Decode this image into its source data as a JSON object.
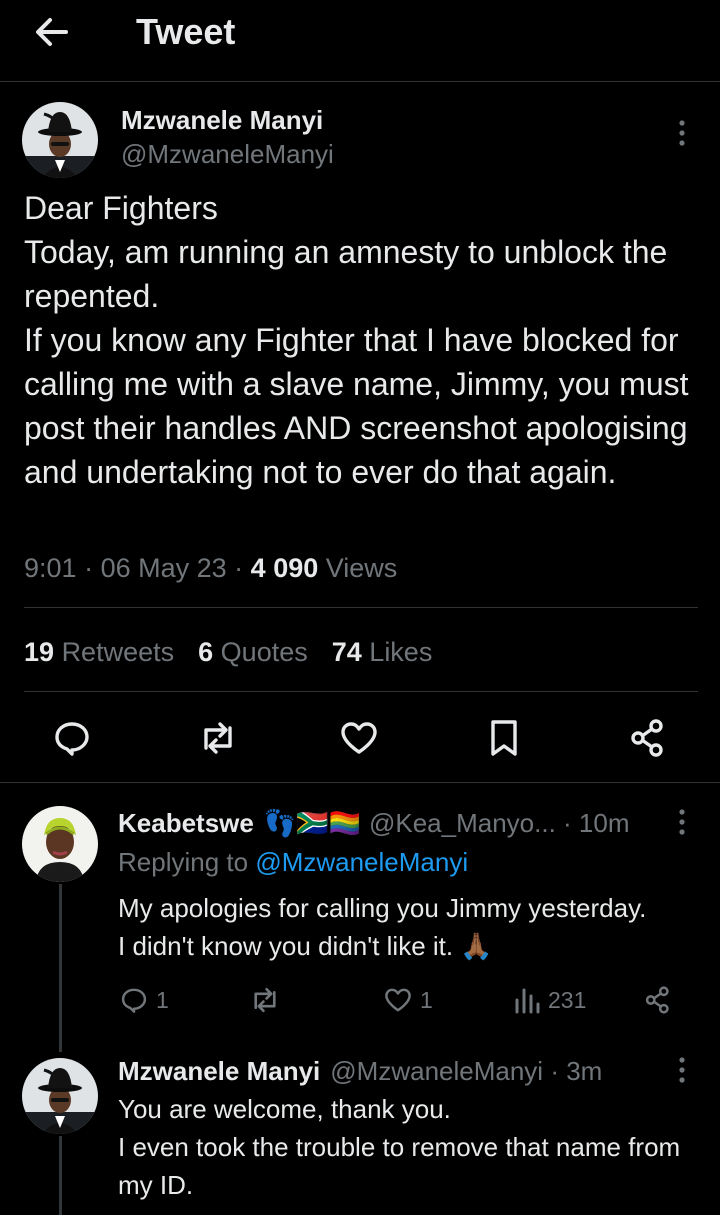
{
  "header": {
    "title": "Tweet",
    "back_icon": "arrow-left-icon"
  },
  "tweet": {
    "author_name": "Mzwanele Manyi",
    "author_handle": "@MzwaneleManyi",
    "text": "Dear Fighters\nToday, am running an amnesty to unblock the repented.\nIf you know any Fighter that I have blocked for calling me with a slave name, Jimmy,  you must post their handles AND screenshot apologising and undertaking not to ever do that again.",
    "time": "9:01",
    "date": "06 May 23",
    "views_count": "4 090",
    "views_label": "Views",
    "retweets_count": "19",
    "retweets_label": "Retweets",
    "quotes_count": "6",
    "quotes_label": "Quotes",
    "likes_count": "74",
    "likes_label": "Likes"
  },
  "replies": [
    {
      "author_name": "Keabetswe",
      "author_emoji": "👣🇿🇦🏳️‍🌈",
      "author_handle": "@Kea_Manyo...",
      "time": "10m",
      "replying_prefix": "Replying to",
      "replying_handle": "@MzwaneleManyi",
      "text": "My apologies for calling you Jimmy yesterday.\nI didn't know you didn't like it. 🙏🏾",
      "reply_count": "1",
      "like_count": "1",
      "view_count": "231"
    },
    {
      "author_name": "Mzwanele Manyi",
      "author_handle": "@MzwaneleManyi",
      "time": "3m",
      "text": "You are welcome, thank you.\nI even took the trouble to remove that name from my ID."
    }
  ],
  "colors": {
    "background": "#000000",
    "text": "#e7e9ea",
    "secondary": "#71767b",
    "link": "#1d9bf0",
    "divider": "#2f3336"
  }
}
